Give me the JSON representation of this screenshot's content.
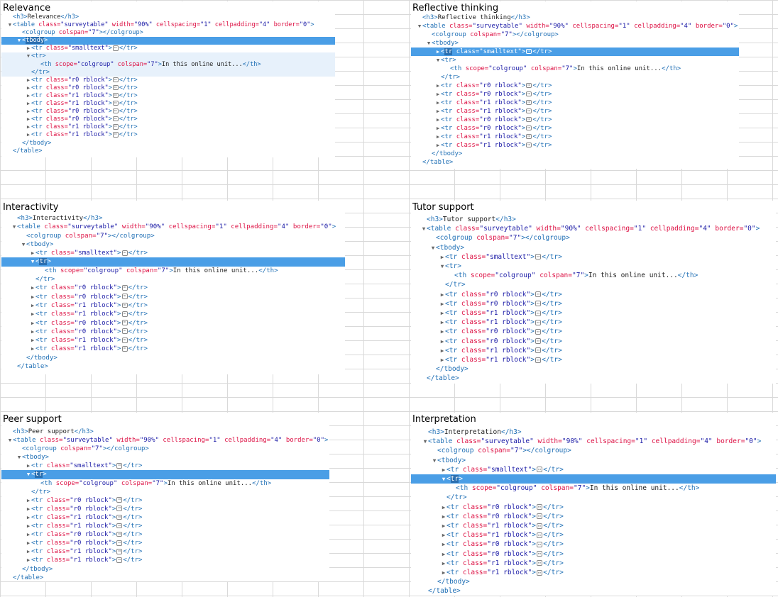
{
  "panels": [
    {
      "title": "Relevance",
      "h3": "Relevance",
      "selected": "tbody",
      "tr_classes": [
        "r0 rblock",
        "r0 rblock",
        "r1 rblock",
        "r1 rblock",
        "r0 rblock",
        "r0 rblock",
        "r1 rblock",
        "r1 rblock"
      ]
    },
    {
      "title": "Reflective thinking",
      "h3": "Reflective thinking",
      "selected": "smalltext",
      "tr_classes": [
        "r0 rblock",
        "r0 rblock",
        "r1 rblock",
        "r1 rblock",
        "r0 rblock",
        "r0 rblock",
        "r1 rblock",
        "r1 rblock"
      ]
    },
    {
      "title": "Interactivity",
      "h3": "Interactivity",
      "selected": "tr",
      "tr_classes": [
        "r0 rblock",
        "r0 rblock",
        "r1 rblock",
        "r1 rblock",
        "r0 rblock",
        "r0 rblock",
        "r1 rblock",
        "r1 rblock"
      ]
    },
    {
      "title": "Tutor support",
      "h3": "Tutor support",
      "selected": "none",
      "tr_classes": [
        "r0 rblock",
        "r0 rblock",
        "r1 rblock",
        "r1 rblock",
        "r0 rblock",
        "r0 rblock",
        "r1 rblock",
        "r1 rblock"
      ]
    },
    {
      "title": "Peer support",
      "h3": "Peer support",
      "selected": "tr",
      "tr_classes": [
        "r0 rblock",
        "r0 rblock",
        "r1 rblock",
        "r1 rblock",
        "r0 rblock",
        "r0 rblock",
        "r1 rblock",
        "r1 rblock"
      ]
    },
    {
      "title": "Interpretation",
      "h3": "Interpretation",
      "selected": "tr",
      "tr_classes": [
        "r0 rblock",
        "r0 rblock",
        "r1 rblock",
        "r1 rblock",
        "r0 rblock",
        "r0 rblock",
        "r1 rblock",
        "r1 rblock"
      ]
    }
  ],
  "code": {
    "table_tag": "table",
    "table_class": "surveytable",
    "table_width": "90%",
    "table_cellspacing": "1",
    "table_cellpadding": "4",
    "table_border": "0",
    "colgroup_colspan": "7",
    "smalltext_class": "smalltext",
    "th_scope": "colgroup",
    "th_colspan": "7",
    "th_text": "In this online unit...",
    "ellipsis": "⋯"
  }
}
